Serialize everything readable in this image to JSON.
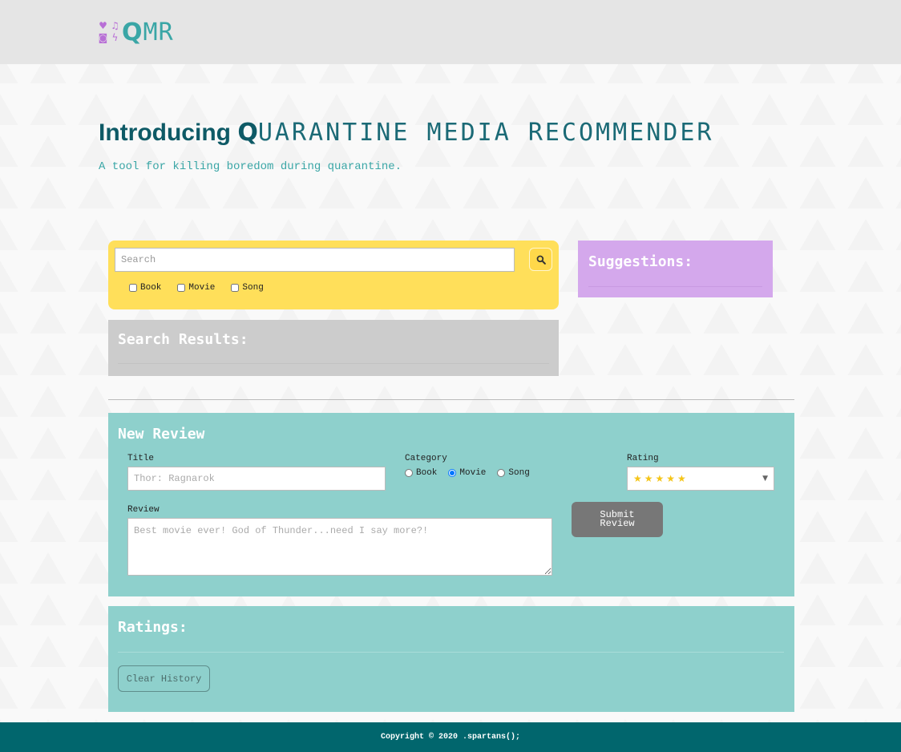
{
  "header": {
    "logo_icons": [
      "heart-icon",
      "music-icon",
      "camera-icon",
      "bolt-icon"
    ],
    "logo_q": "Q",
    "logo_rest": "MR"
  },
  "hero": {
    "title_prefix": "Introducing ",
    "title_q": "Q",
    "title_rest": "UARANTINE MEDIA RECOMMENDER",
    "subtitle": "A tool for killing boredom during quarantine."
  },
  "search": {
    "placeholder": "Search",
    "button_icon": "search-icon",
    "filters": [
      {
        "label": "Book",
        "checked": false
      },
      {
        "label": "Movie",
        "checked": false
      },
      {
        "label": "Song",
        "checked": false
      }
    ]
  },
  "results": {
    "title": "Search Results:"
  },
  "suggestions": {
    "title": "Suggestions:"
  },
  "new_review": {
    "title": "New Review",
    "title_label": "Title",
    "title_placeholder": "Thor: Ragnarok",
    "category_label": "Category",
    "categories": [
      {
        "label": "Book",
        "selected": false
      },
      {
        "label": "Movie",
        "selected": true
      },
      {
        "label": "Song",
        "selected": false
      }
    ],
    "rating_label": "Rating",
    "rating_value": "★★★★★",
    "review_label": "Review",
    "review_placeholder": "Best movie ever! God of Thunder...need I say more?!",
    "submit_label": "Submit Review"
  },
  "ratings": {
    "title": "Ratings:",
    "clear_label": "Clear History"
  },
  "footer": {
    "text": "Copyright © 2020 .spartans();"
  },
  "colors": {
    "topbar": "#e5e5e5",
    "search_panel": "#ffdf5a",
    "suggestions_panel": "#d4a8ec",
    "results_panel": "#cccccc",
    "review_panel": "#8ed0cc",
    "footer": "#01666d",
    "accent_teal": "#3aa6a6"
  }
}
